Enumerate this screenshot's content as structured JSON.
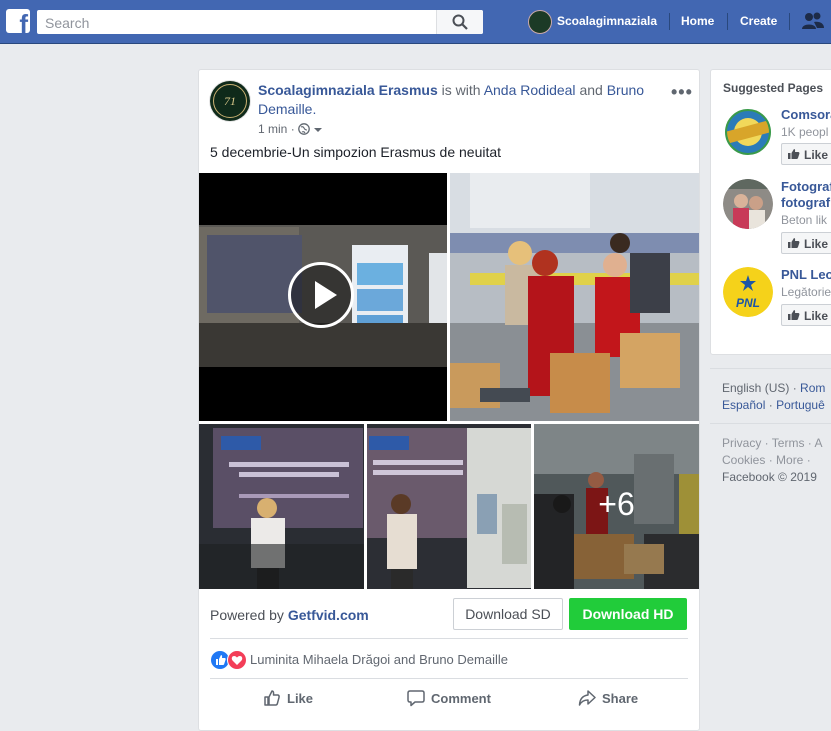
{
  "topbar": {
    "logo": "f",
    "search_placeholder": "Search",
    "profile_name": "Scoalagimnaziala",
    "home": "Home",
    "create": "Create"
  },
  "post": {
    "author": "Scoalagimnaziala Erasmus",
    "with_text": "is with",
    "tag1": "Anda Rodideal",
    "and_text": "and",
    "tag2": "Bruno Demaille.",
    "time": "1 min",
    "avatar_text": "71",
    "text": "5 decembrie-Un simpozion Erasmus de neuitat",
    "more_photos": "+6",
    "powered_label": "Powered by",
    "powered_site": "Getfvid.com",
    "download_sd": "Download SD",
    "download_hd": "Download HD",
    "reactions_text": "Luminita Mihaela Drăgoi and Bruno Demaille",
    "actions": {
      "like": "Like",
      "comment": "Comment",
      "share": "Share"
    }
  },
  "suggested": {
    "title": "Suggested Pages",
    "pages": [
      {
        "name": "Comsora",
        "sub": "1K peopl",
        "like": "Like"
      },
      {
        "name": "Fotograf",
        "name2": "fotograf",
        "sub": "Beton lik",
        "like": "Like"
      },
      {
        "name": "PNL Leo",
        "sub": "Legătorie",
        "like": "Like",
        "badge": "PNL"
      }
    ]
  },
  "footer": {
    "lang1": "English (US)",
    "lang2": "Rom",
    "lang3": "Español",
    "lang4": "Portuguê",
    "privacy": "Privacy · Terms · A",
    "cookies": "Cookies · More ·",
    "copyright": "Facebook © 2019"
  },
  "colors": {
    "brand": "#4267b2",
    "link": "#385898",
    "download_hd": "#21cc3a"
  }
}
